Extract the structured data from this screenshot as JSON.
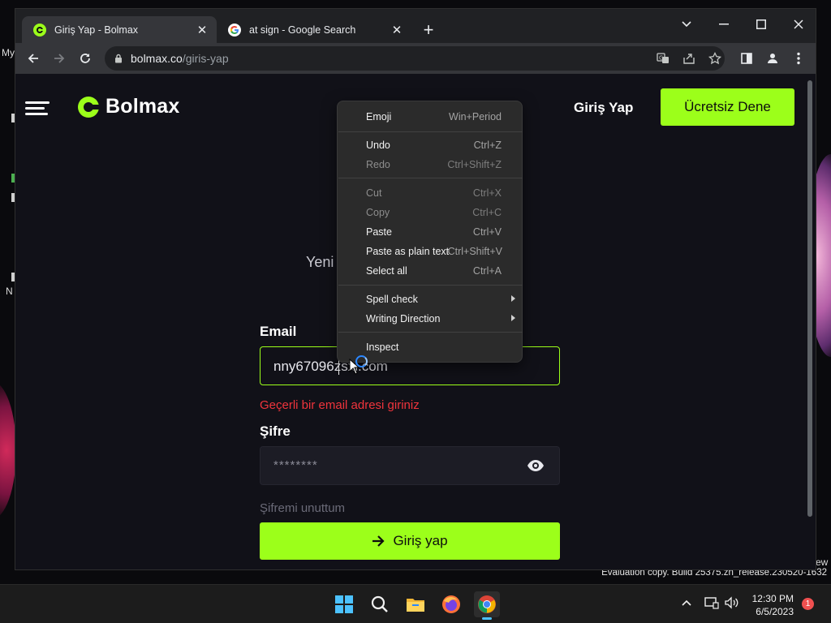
{
  "desktop": {
    "snippets": [
      "My",
      "N",
      "ew"
    ],
    "evaluation_text": "Evaluation copy. Build 25375.zn_release.230520-1632"
  },
  "browser": {
    "tabs": [
      {
        "title": "Giriş Yap - Bolmax",
        "favicon": "bolmax-favicon",
        "active": true
      },
      {
        "title": "at sign - Google Search",
        "favicon": "google-favicon",
        "active": false
      }
    ],
    "address": {
      "host": "bolmax.co",
      "path": "/giris-yap"
    },
    "window_controls": [
      "tab-search",
      "minimize",
      "maximize",
      "close"
    ]
  },
  "site": {
    "brand": "Bolmax",
    "nav_login": "Giriş Yap",
    "cta_label": "Ücretsiz Dene",
    "subheading_partial": "Yeni",
    "email_label": "Email",
    "email_value_before_cursor": "nny67096",
    "email_value_after_cursor": "zsxi.com",
    "email_error": "Geçerli bir email adresi giriniz",
    "password_label": "Şifre",
    "password_placeholder": "********",
    "forgot_password": "Şifremi unuttum",
    "submit_label": "Giriş yap",
    "accent_color": "#9cff1a",
    "error_color": "#f0343c"
  },
  "context_menu": {
    "items": [
      {
        "label": "Emoji",
        "shortcut": "Win+Period",
        "enabled": true
      },
      {
        "label": "Undo",
        "shortcut": "Ctrl+Z",
        "enabled": true
      },
      {
        "label": "Redo",
        "shortcut": "Ctrl+Shift+Z",
        "enabled": false
      },
      {
        "label": "Cut",
        "shortcut": "Ctrl+X",
        "enabled": false
      },
      {
        "label": "Copy",
        "shortcut": "Ctrl+C",
        "enabled": false
      },
      {
        "label": "Paste",
        "shortcut": "Ctrl+V",
        "enabled": true
      },
      {
        "label": "Paste as plain text",
        "shortcut": "Ctrl+Shift+V",
        "enabled": true
      },
      {
        "label": "Select all",
        "shortcut": "Ctrl+A",
        "enabled": true
      },
      {
        "label": "Spell check",
        "submenu": true,
        "enabled": true
      },
      {
        "label": "Writing Direction",
        "submenu": true,
        "enabled": true
      },
      {
        "label": "Inspect",
        "enabled": true
      }
    ]
  },
  "taskbar": {
    "apps": [
      "start-icon",
      "search-icon",
      "file-explorer-icon",
      "firefox-icon",
      "chrome-icon"
    ],
    "clock_time": "12:30 PM",
    "clock_date": "6/5/2023",
    "notification_count": "1"
  }
}
